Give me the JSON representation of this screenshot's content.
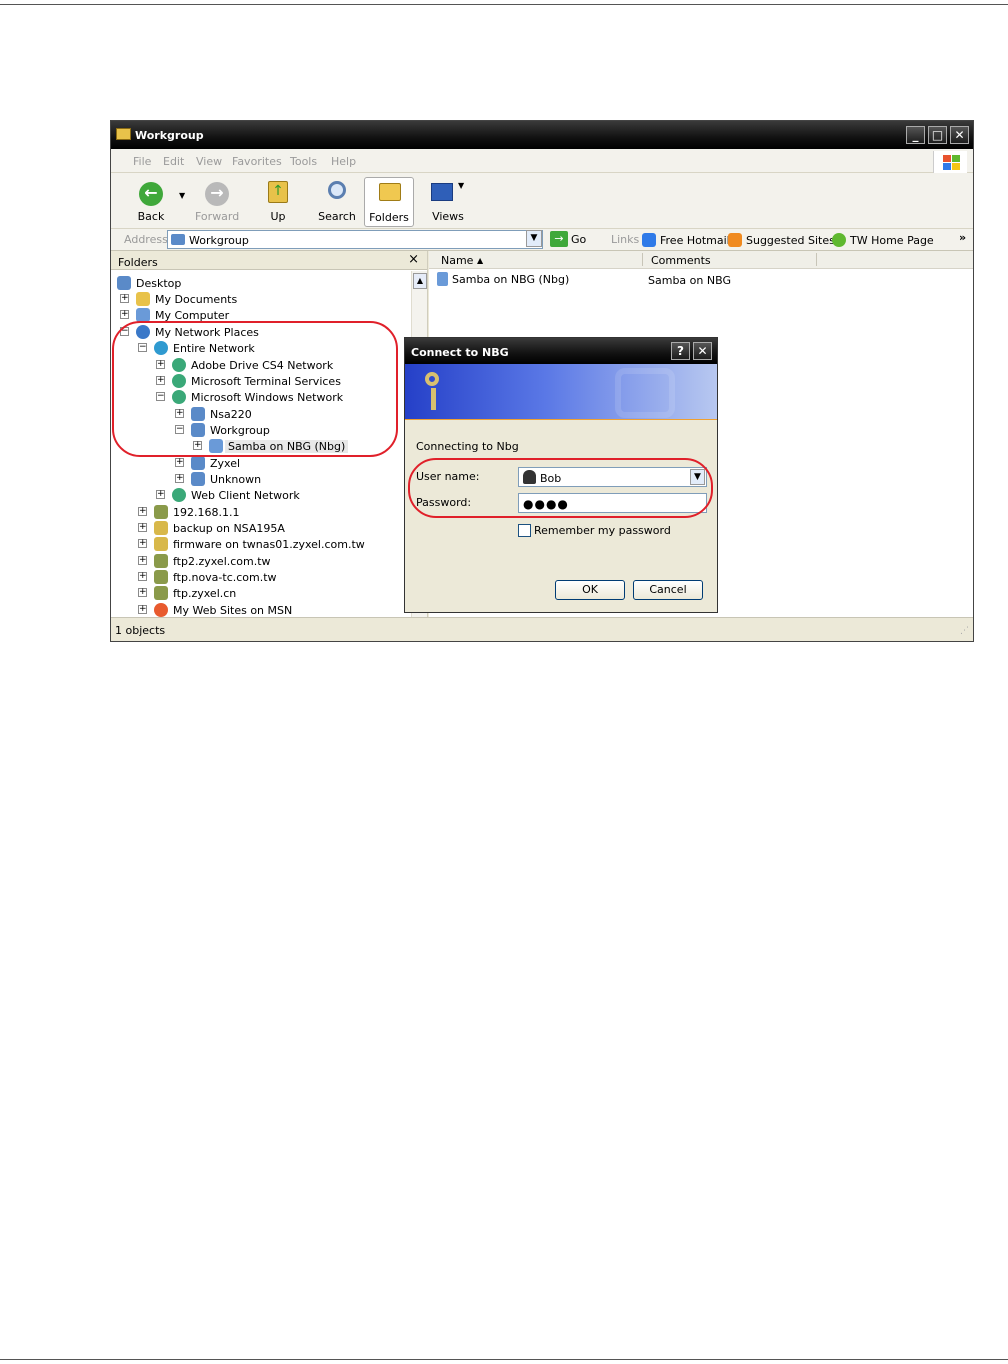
{
  "window": {
    "title": "Workgroup",
    "controls": {
      "minimize": "_",
      "maximize": "□",
      "close": "✕"
    }
  },
  "menu": [
    "File",
    "Edit",
    "View",
    "Favorites",
    "Tools",
    "Help"
  ],
  "toolbar": {
    "back": "Back",
    "forward": "Forward",
    "up": "Up",
    "search": "Search",
    "folders": "Folders",
    "views": "Views"
  },
  "address": {
    "label": "Address",
    "value": "Workgroup",
    "go": "Go",
    "links_label": "Links",
    "links": [
      "Free Hotmail",
      "Suggested Sites",
      "TW Home Page"
    ],
    "more": "»"
  },
  "folders_pane": {
    "title": "Folders",
    "close": "×",
    "tree": [
      {
        "label": "Desktop"
      },
      {
        "label": "My Documents",
        "expander": "+"
      },
      {
        "label": "My Computer",
        "expander": "+"
      },
      {
        "label": "My Network Places",
        "expander": "−"
      },
      {
        "label": "Entire Network",
        "expander": "−"
      },
      {
        "label": "Adobe Drive CS4 Network",
        "expander": "+"
      },
      {
        "label": "Microsoft Terminal Services",
        "expander": "+"
      },
      {
        "label": "Microsoft Windows Network",
        "expander": "−"
      },
      {
        "label": "Nsa220",
        "expander": "+"
      },
      {
        "label": "Workgroup",
        "expander": "−"
      },
      {
        "label": "Samba on NBG (Nbg)",
        "expander": "+"
      },
      {
        "label": "Zyxel",
        "expander": "+"
      },
      {
        "label": "Unknown",
        "expander": "+"
      },
      {
        "label": "Web Client Network",
        "expander": "+"
      },
      {
        "label": "192.168.1.1",
        "expander": "+"
      },
      {
        "label": "backup on NSA195A",
        "expander": "+"
      },
      {
        "label": "firmware on twnas01.zyxel.com.tw",
        "expander": "+"
      },
      {
        "label": "ftp2.zyxel.com.tw",
        "expander": "+"
      },
      {
        "label": "ftp.nova-tc.com.tw",
        "expander": "+"
      },
      {
        "label": "ftp.zyxel.cn",
        "expander": "+"
      },
      {
        "label": "My Web Sites on MSN",
        "expander": "+"
      }
    ]
  },
  "content": {
    "columns": {
      "name": "Name",
      "sort_indicator": "▲",
      "comments": "Comments"
    },
    "items": [
      {
        "name": "Samba on NBG (Nbg)",
        "comment": "Samba on NBG"
      }
    ]
  },
  "status": "1 objects",
  "dialog": {
    "title": "Connect to NBG",
    "help": "?",
    "close": "✕",
    "connecting": "Connecting to Nbg",
    "username_label": "User name:",
    "username_value": "Bob",
    "password_label": "Password:",
    "password_value": "●●●●",
    "remember": "Remember my password",
    "ok": "OK",
    "cancel": "Cancel"
  },
  "colors": {
    "highlight": "#e0202a",
    "title_bar": "#111111",
    "banner": "#2540c8"
  }
}
